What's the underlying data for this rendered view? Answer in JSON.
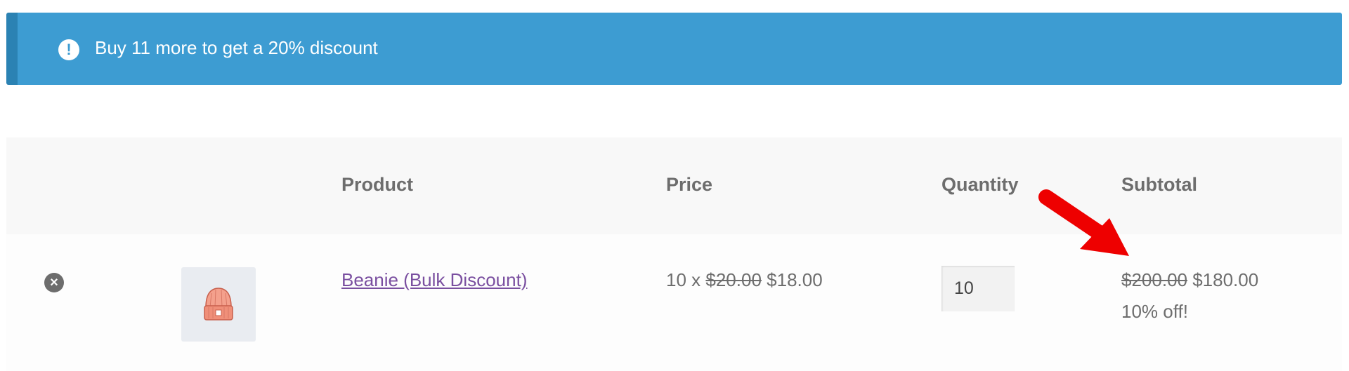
{
  "notice": {
    "icon": "exclamation-circle-icon",
    "glyph": "!",
    "message": "Buy 11 more to get a 20% discount",
    "background": "#3d9cd2",
    "accent": "#2b82b3"
  },
  "table": {
    "headers": {
      "product": "Product",
      "price": "Price",
      "quantity": "Quantity",
      "subtotal": "Subtotal"
    },
    "rows": [
      {
        "remove_icon": "close-circle-icon",
        "remove_glyph": "×",
        "thumbnail_icon": "beanie-icon",
        "product_name": "Beanie (Bulk Discount)",
        "price_prefix": "10 x",
        "price_original": "$20.00",
        "price_discounted": "$18.00",
        "quantity": "10",
        "subtotal_original": "$200.00",
        "subtotal_discounted": "$180.00",
        "discount_note": "10% off!"
      }
    ]
  },
  "annotation": {
    "icon": "red-arrow-icon",
    "color": "#ee0000"
  },
  "colors": {
    "link": "#7a4fa0",
    "text": "#6d6d6d",
    "header_bg": "#f8f8f8"
  }
}
